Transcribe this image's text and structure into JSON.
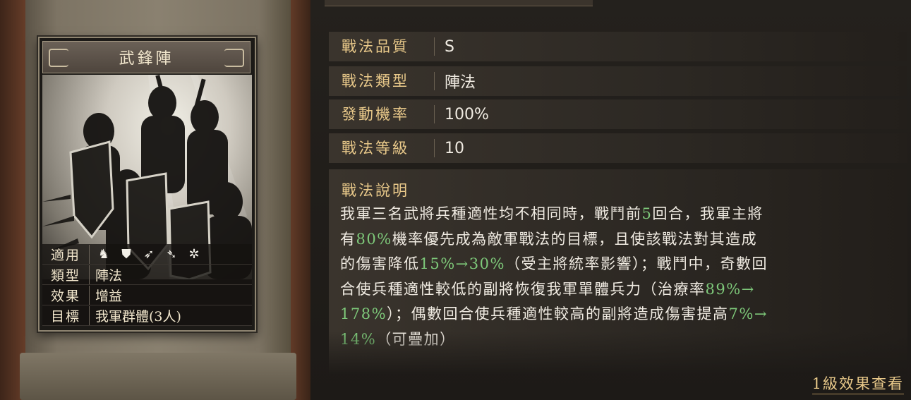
{
  "card": {
    "title": "武鋒陣",
    "info": [
      {
        "key": "適用",
        "value": "",
        "icons": [
          "cavalry-icon",
          "shield-icon",
          "bow-icon",
          "spear-icon",
          "wheel-icon"
        ]
      },
      {
        "key": "類型",
        "value": "陣法"
      },
      {
        "key": "效果",
        "value": "增益"
      },
      {
        "key": "目標",
        "value": "我軍群體(3人)"
      }
    ]
  },
  "attributes": [
    {
      "key": "戰法品質",
      "value": "S"
    },
    {
      "key": "戰法類型",
      "value": "陣法"
    },
    {
      "key": "發動機率",
      "value": "100%"
    },
    {
      "key": "戰法等級",
      "value": "10"
    }
  ],
  "description": {
    "title": "戰法說明",
    "lines": [
      [
        {
          "t": "我軍三名武將兵種適性均不相同時，戰鬥前"
        },
        {
          "t": "5",
          "hl": true
        },
        {
          "t": "回合，我軍主將"
        }
      ],
      [
        {
          "t": "有"
        },
        {
          "t": "80%",
          "hl": true
        },
        {
          "t": "機率優先成為敵軍戰法的目標，且使該戰法對其造成"
        }
      ],
      [
        {
          "t": "的傷害降低"
        },
        {
          "t": "15%→30%",
          "hl": true
        },
        {
          "t": "（受主將統率影響）；戰鬥中，奇數回"
        }
      ],
      [
        {
          "t": "合使兵種適性較低的副將恢復我軍單體兵力（治療率"
        },
        {
          "t": "89%→",
          "hl": true
        }
      ],
      [
        {
          "t": "178%",
          "hl": true
        },
        {
          "t": "）；偶數回合使兵種適性較高的副將造成傷害提高"
        },
        {
          "t": "7%→",
          "hl": true
        }
      ],
      [
        {
          "t": "14%",
          "hl": true
        },
        {
          "t": "（可疊加）"
        }
      ]
    ]
  },
  "level_link": "1級效果查看",
  "colors": {
    "gold_label": "#e9c98a",
    "highlight_green": "#7ec97a",
    "text": "#f0ebe2"
  }
}
